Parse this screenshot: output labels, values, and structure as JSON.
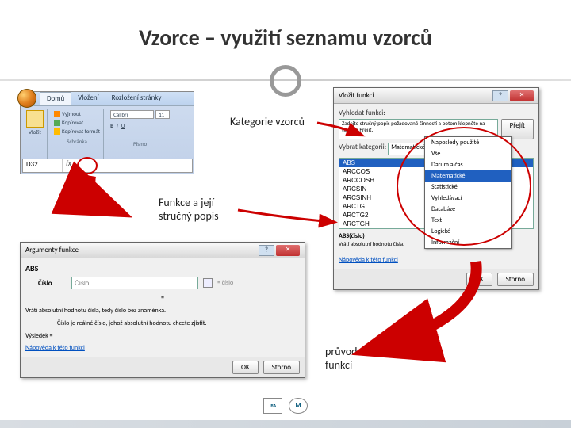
{
  "title": "Vzorce – využití seznamu vzorců",
  "ribbon": {
    "tabs": [
      "Domů",
      "Vložení",
      "Rozložení stránky"
    ],
    "active_tab": 0,
    "clipboard": {
      "paste": "Vložit",
      "cut": "Vyjmout",
      "copy": "Kopírovat",
      "fmt": "Kopírovat formát",
      "group": "Schránka"
    },
    "font": {
      "name": "Calibri",
      "size": "11",
      "bold": "B",
      "italic": "I",
      "underline": "U",
      "group": "Písmo"
    },
    "namebox": "D32",
    "fx": "fx"
  },
  "annot": {
    "category": "Kategorie vzorců",
    "funcdesc": "Funkce a její\nstručný popis",
    "wizard": "průvodce\nfunkcí"
  },
  "insert_fn": {
    "title": "Vložit funkci",
    "search_label": "Vyhledat funkci:",
    "search_text": "Zadejte stručný popis požadované činnosti a potom klepněte na tlačítko Přejít.",
    "go": "Přejít",
    "cat_label": "Vybrat kategorii:",
    "cat_value": "Matematické",
    "cat_options": [
      "Naposledy použité",
      "Vše",
      "Datum a čas",
      "Matematické",
      "Statistické",
      "Vyhledávací",
      "Databáze",
      "Text",
      "Logické",
      "Informační"
    ],
    "cat_highlight": 3,
    "list": [
      "ABS",
      "ARCCOS",
      "ARCCOSH",
      "ARCSIN",
      "ARCSINH",
      "ARCTG",
      "ARCTG2",
      "ARCTGH"
    ],
    "sig": "ABS(číslo)",
    "desc": "Vrátí absolutní hodnotu čísla.",
    "help": "Nápověda k této funkci",
    "ok": "OK",
    "cancel": "Storno"
  },
  "args": {
    "title": "Argumenty funkce",
    "fname": "ABS",
    "arg_name": "Číslo",
    "arg_hint": "= číslo",
    "result": "=",
    "desc": "Vrátí absolutní hodnotu čísla, tedy číslo bez znaménka.",
    "arg_desc": "Číslo  je reálné číslo, jehož absolutní hodnotu chcete zjistit.",
    "output_label": "Výsledek =",
    "help": "Nápověda k této funkci",
    "ok": "OK",
    "cancel": "Storno"
  },
  "logos": {
    "iba": "IBA",
    "mu": "M"
  }
}
